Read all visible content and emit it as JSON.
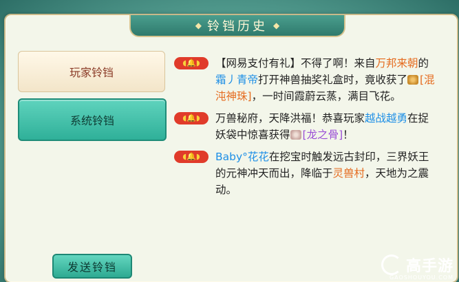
{
  "title": "铃铛历史",
  "sidebar": {
    "items": [
      {
        "label": "玩家铃铛",
        "active": false
      },
      {
        "label": "系统铃铛",
        "active": true
      }
    ]
  },
  "messages": [
    {
      "parts": [
        {
          "text": "【网易支付有礼】不得了啊！来自",
          "color": "default"
        },
        {
          "text": "万邦来朝",
          "color": "orange"
        },
        {
          "text": "的",
          "color": "default"
        },
        {
          "text": "霜丿青帝",
          "color": "blue"
        },
        {
          "text": "打开神兽抽奖礼盒时，竟收获了",
          "color": "default"
        },
        {
          "icon": "treasure-icon"
        },
        {
          "text": "[混沌神珠]",
          "color": "orange"
        },
        {
          "text": "，一时间霞蔚云蒸，满目飞花。",
          "color": "default"
        }
      ]
    },
    {
      "parts": [
        {
          "text": "万兽秘府，天降洪福！恭喜玩家",
          "color": "default"
        },
        {
          "text": "越战越勇",
          "color": "blue"
        },
        {
          "text": "在捉妖袋中惊喜获得",
          "color": "default"
        },
        {
          "icon": "bone-icon"
        },
        {
          "text": "[龙之骨]",
          "color": "purple"
        },
        {
          "text": "！",
          "color": "default"
        }
      ]
    },
    {
      "parts": [
        {
          "text": "Baby°花花",
          "color": "blue"
        },
        {
          "text": "在挖宝时触发远古封印，三界妖王的元神冲天而出，降临于",
          "color": "default"
        },
        {
          "text": "灵兽村",
          "color": "orange"
        },
        {
          "text": "，天地为之震动。",
          "color": "default"
        }
      ]
    }
  ],
  "send_button": "发送铃铛",
  "watermark": {
    "name": "高手游",
    "url": "GAOSHOUYOU.COM"
  },
  "colors": {
    "orange": "#e56b1f",
    "blue": "#1e8fe6",
    "purple": "#9b4fd6",
    "bell": "#e03b2a"
  }
}
